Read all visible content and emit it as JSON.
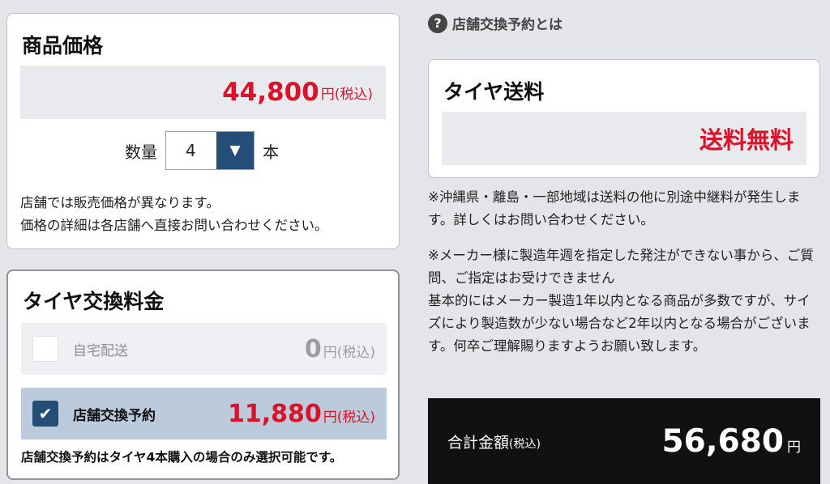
{
  "price": {
    "title": "商品価格",
    "amount": "44,800",
    "unit": "円(税込)",
    "quantity_label": "数量",
    "quantity_value": "4",
    "quantity_unit": "本",
    "note_1": "店舗では販売価格が異なります。",
    "note_2": "価格の詳細は各店舗へ直接お問い合わせください。"
  },
  "exchange": {
    "title": "タイヤ交換料金",
    "options": [
      {
        "label": "自宅配送",
        "amount": "0",
        "unit": "円(税込)",
        "checked": false
      },
      {
        "label": "店舗交換予約",
        "amount": "11,880",
        "unit": "円(税込)",
        "checked": true
      }
    ],
    "note": "店舗交換予約はタイヤ4本購入の場合のみ選択可能です。"
  },
  "help": {
    "label": "店舗交換予約とは",
    "icon": "question-icon"
  },
  "shipping": {
    "title": "タイヤ送料",
    "value": "送料無料"
  },
  "notes": {
    "note_1": "※沖縄県・離島・一部地域は送料の他に別途中継料が発生します。詳しくはお問い合わせください。",
    "note_2": "※メーカー様に製造年週を指定した発注ができない事から、ご質問、ご指定はお受けできません",
    "note_3": "基本的にはメーカー製造1年以内となる商品が多数ですが、サイズにより製造数が少ない場合など2年以内となる場合がございます。何卒ご理解賜りますようお願い致します。"
  },
  "total": {
    "label": "合計金額",
    "label_suffix": "(税込)",
    "amount": "56,680",
    "unit": "円"
  },
  "colors": {
    "accent_red": "#d9132a",
    "accent_navy": "#244e78",
    "background": "#e4e5e9"
  }
}
